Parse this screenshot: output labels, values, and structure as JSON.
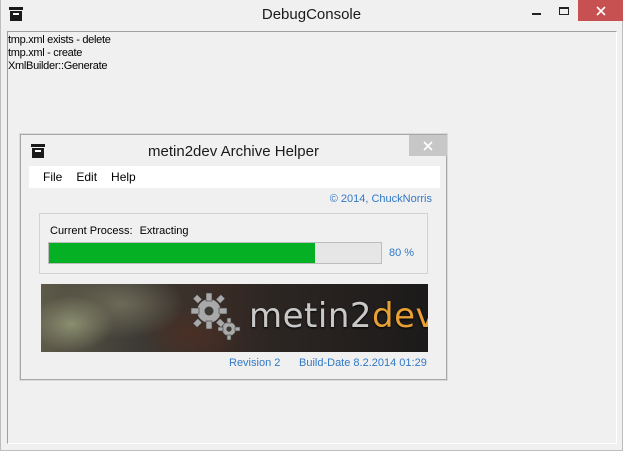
{
  "console": {
    "title": "DebugConsole",
    "log_lines": [
      "tmp.xml exists - delete",
      "tmp.xml - create",
      "XmlBuilder::Generate"
    ]
  },
  "helper": {
    "title": "metin2dev Archive Helper",
    "menu": [
      "File",
      "Edit",
      "Help"
    ],
    "copyright": "© 2014, ChuckNorris",
    "process_label": "Current Process:",
    "process_value": "Extracting",
    "progress_percent": 80,
    "progress_text": "80 %",
    "banner": {
      "logo_main": "metin2",
      "logo_accent": "dev"
    },
    "revision": "Revision 2",
    "build_date": "Build-Date 8.2.2014 01:29"
  },
  "colors": {
    "progress_fill": "#06b025",
    "link_blue": "#3178c6",
    "close_red": "#c75050",
    "logo_accent": "#e8a035"
  },
  "icons": {
    "app": "archive-box-icon",
    "minimize": "minimize-icon",
    "maximize": "maximize-icon",
    "close": "close-icon",
    "banner": "gears-icon"
  }
}
